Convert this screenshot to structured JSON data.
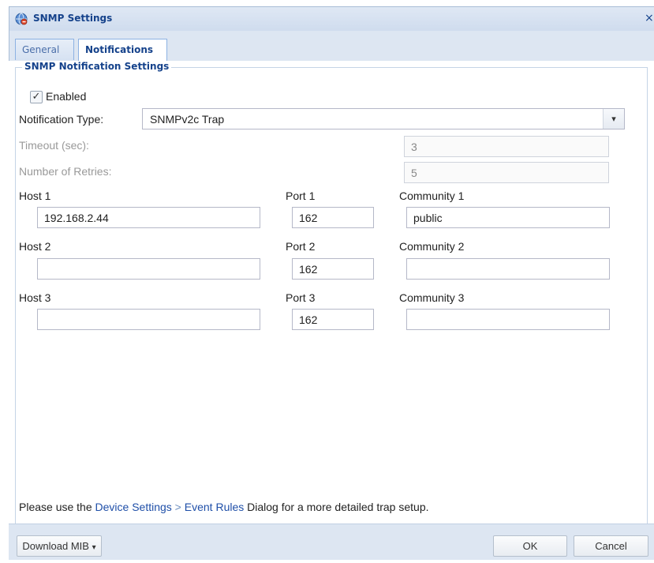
{
  "window": {
    "title": "SNMP Settings",
    "close_symbol": "×"
  },
  "tabs": [
    {
      "label": "General",
      "active": false
    },
    {
      "label": "Notifications",
      "active": true
    }
  ],
  "group": {
    "legend": "SNMP Notification Settings"
  },
  "enabled": {
    "label": "Enabled",
    "checked": true,
    "check_glyph": "✓"
  },
  "notification_type": {
    "label": "Notification Type:",
    "value": "SNMPv2c Trap",
    "arrow_glyph": "▾"
  },
  "timeout": {
    "label": "Timeout (sec):",
    "value": "3"
  },
  "retries": {
    "label": "Number of Retries:",
    "value": "5"
  },
  "hosts": [
    {
      "host_label": "Host 1",
      "host_value": "192.168.2.44",
      "port_label": "Port 1",
      "port_value": "162",
      "community_label": "Community 1",
      "community_value": "public"
    },
    {
      "host_label": "Host 2",
      "host_value": "",
      "port_label": "Port 2",
      "port_value": "162",
      "community_label": "Community 2",
      "community_value": ""
    },
    {
      "host_label": "Host 3",
      "host_value": "",
      "port_label": "Port 3",
      "port_value": "162",
      "community_label": "Community 3",
      "community_value": ""
    }
  ],
  "hint": {
    "prefix": "Please use the ",
    "link1": "Device Settings",
    "separator": " > ",
    "link2": "Event Rules",
    "suffix": " Dialog for a more detailed trap setup."
  },
  "footer": {
    "download_label": "Download MIB",
    "download_arrow": "▾",
    "ok_label": "OK",
    "cancel_label": "Cancel"
  },
  "colors": {
    "title_text": "#15428b",
    "link": "#1f4fa8",
    "panel_bg": "#eaf0f8"
  }
}
